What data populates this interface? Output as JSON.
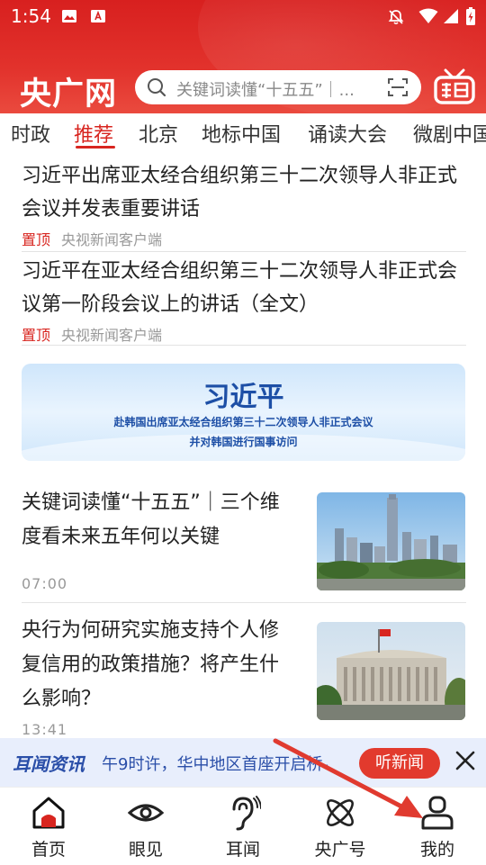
{
  "status_bar": {
    "time": "1:54"
  },
  "header": {
    "logo": "央广网",
    "search_placeholder": "关键词读懂“十五五”｜...",
    "icons": [
      "search-icon",
      "scan-icon",
      "cctv-tv-icon"
    ]
  },
  "tabs": [
    {
      "label": "时政"
    },
    {
      "label": "推荐",
      "active": true
    },
    {
      "label": "北京"
    },
    {
      "label": "地标中国"
    },
    {
      "label": "诵读大会"
    },
    {
      "label": "微剧中国"
    }
  ],
  "pinned": [
    {
      "title": "习近平出席亚太经合组织第三十二次领导人非正式会议并发表重要讲话",
      "pin": "置顶",
      "source": "央视新闻客户端"
    },
    {
      "title": "习近平在亚太经合组织第三十二次领导人非正式会议第一阶段会议上的讲话（全文）",
      "pin": "置顶",
      "source": "央视新闻客户端"
    }
  ],
  "banner": {
    "headline": "习近平",
    "line1": "赴韩国出席亚太经合组织第三十二次领导人非正式会议",
    "line2": "并对韩国进行国事访问"
  },
  "stories": [
    {
      "title": "关键词读懂“十五五”｜三个维度看未来五年何以关键",
      "time": "07:00",
      "thumb": "city-skyline-image"
    },
    {
      "title": "央行为何研究实施支持个人修复信用的政策措施？将产生什么影响？",
      "time": "13:41",
      "thumb": "central-bank-building-image"
    }
  ],
  "radio_bar": {
    "brand": "耳闻资讯",
    "ticker": "午9时许，华中地区首座开启桥-",
    "listen_button": "听新闻"
  },
  "bottom_nav": [
    {
      "label": "首页",
      "icon": "home-icon",
      "active": true
    },
    {
      "label": "眼见",
      "icon": "eye-icon"
    },
    {
      "label": "耳闻",
      "icon": "ear-icon"
    },
    {
      "label": "央广号",
      "icon": "atom-icon"
    },
    {
      "label": "我的",
      "icon": "user-icon"
    }
  ],
  "colors": {
    "brand_red": "#d8251f",
    "radio_blue": "#2a4ea8",
    "annotation_arrow": "#e03a2f"
  }
}
